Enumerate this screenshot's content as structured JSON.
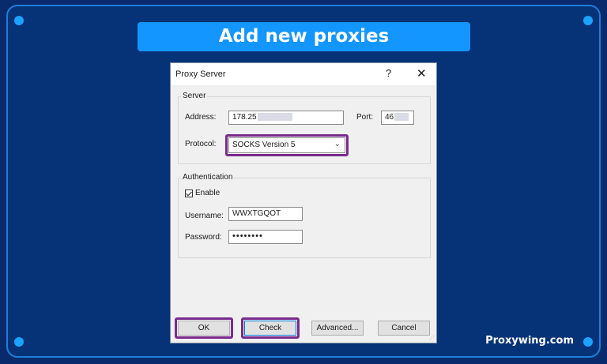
{
  "banner": {
    "title": "Add new proxies"
  },
  "brand": "Proxywing.com",
  "dialog": {
    "title": "Proxy Server",
    "help_glyph": "?",
    "close_glyph": "✕",
    "server": {
      "group_label": "Server",
      "address_label": "Address:",
      "address_value": "178.25",
      "port_label": "Port:",
      "port_value": "46",
      "protocol_label": "Protocol:",
      "protocol_value": "SOCKS Version 5"
    },
    "auth": {
      "group_label": "Authentication",
      "enable_label": "Enable",
      "enable_checked": true,
      "username_label": "Username:",
      "username_value": "WWXTGQOT",
      "password_label": "Password:",
      "password_value": "••••••••"
    },
    "buttons": {
      "ok": "OK",
      "check": "Check",
      "advanced": "Advanced...",
      "cancel": "Cancel"
    }
  },
  "colors": {
    "background": "#063277",
    "frame_border": "#1e7fd8",
    "banner": "#1396ff",
    "highlight": "#7a2a8c"
  },
  "icons": [
    "help-icon",
    "close-icon",
    "chevron-down-icon",
    "checkbox-checked-icon"
  ]
}
